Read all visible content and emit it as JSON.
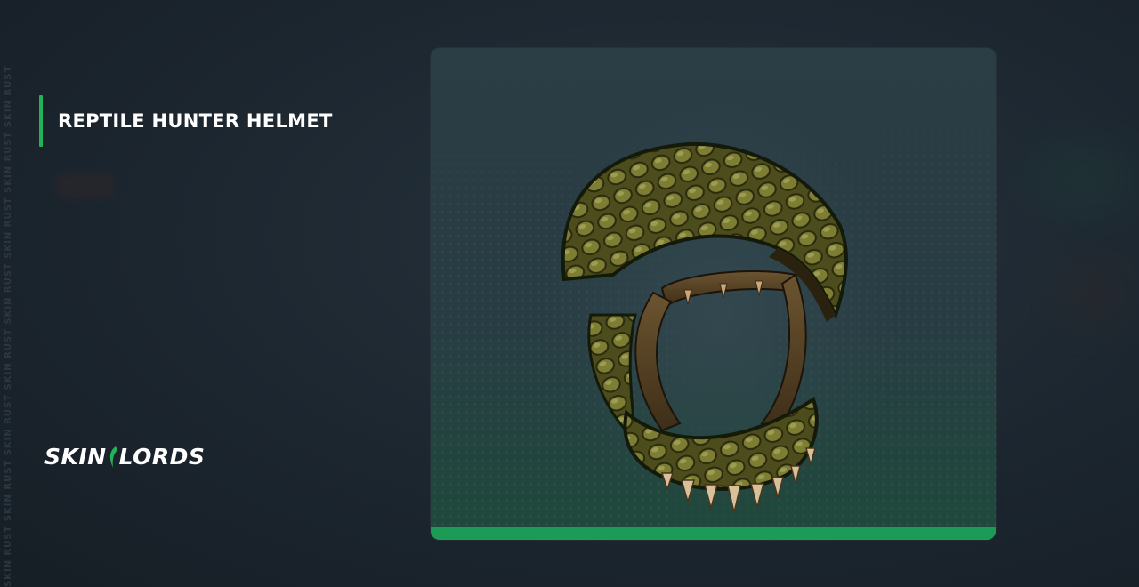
{
  "item": {
    "title": "REPTILE HUNTER HELMET"
  },
  "watermark": {
    "text": "SKIN RUST SKIN RUST SKIN RUST SKIN RUST SKIN RUST SKIN RUST SKIN RUST SKIN RUST"
  },
  "logo": {
    "left": "SKIN",
    "right": "LORDS"
  },
  "colors": {
    "accent": "#22b25a",
    "card_bar": "#1c9b56",
    "background": "#1c262f"
  },
  "icons": {
    "item_image": "reptile-helmet-icon",
    "logo_mark": "claw-icon"
  }
}
